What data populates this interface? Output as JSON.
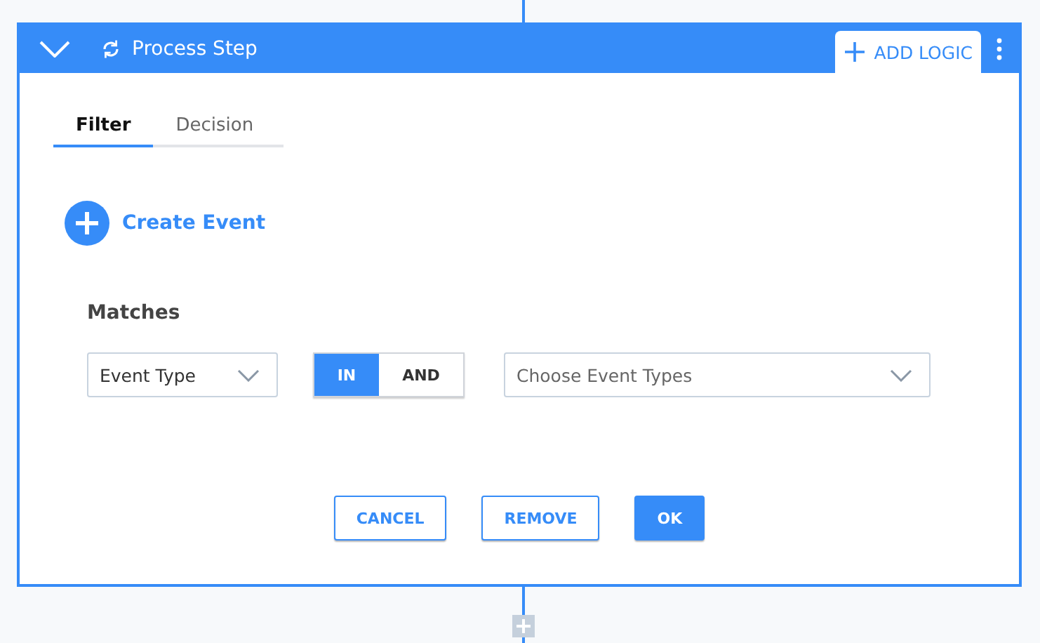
{
  "header": {
    "title": "Process Step",
    "add_logic": "ADD LOGIC"
  },
  "tabs": [
    {
      "label": "Filter",
      "selected": true
    },
    {
      "label": "Decision",
      "selected": false
    }
  ],
  "create_event": "Create Event",
  "matches": {
    "label": "Matches",
    "field": "Event Type",
    "operators": [
      {
        "label": "IN",
        "selected": true
      },
      {
        "label": "AND",
        "selected": false
      }
    ],
    "event_types": {
      "placeholder": "Choose Event Types"
    }
  },
  "buttons": [
    {
      "label": "CANCEL",
      "kind": "outline"
    },
    {
      "label": "REMOVE",
      "kind": "outline"
    },
    {
      "label": "OK",
      "kind": "primary"
    }
  ]
}
